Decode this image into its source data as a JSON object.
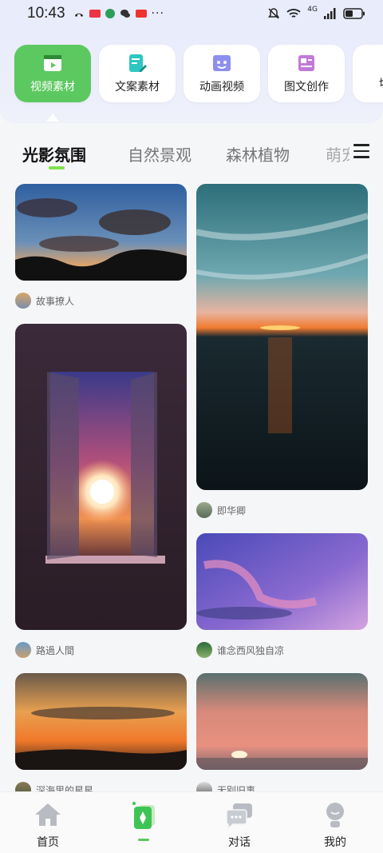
{
  "status_bar": {
    "time": "10:43",
    "network_label": "4G",
    "battery_level": 0.4
  },
  "categories": [
    {
      "label": "视频素材",
      "icon": "film-icon",
      "active": true
    },
    {
      "label": "文案素材",
      "icon": "document-pen-icon",
      "active": false
    },
    {
      "label": "动画视频",
      "icon": "animation-icon",
      "active": false
    },
    {
      "label": "图文创作",
      "icon": "image-text-icon",
      "active": false
    },
    {
      "label": "切",
      "icon": "cut-icon",
      "active": false
    }
  ],
  "tabs": [
    {
      "label": "光影氛围",
      "active": true
    },
    {
      "label": "自然景观",
      "active": false
    },
    {
      "label": "森林植物",
      "active": false
    },
    {
      "label": "萌宠",
      "active": false
    }
  ],
  "feed": {
    "left": [
      {
        "author": "故事撩人",
        "scene": "dusk-clouds"
      },
      {
        "author": "路過人間",
        "scene": "window-sunset"
      },
      {
        "author": "深海里的星星",
        "scene": "golden-sunset"
      }
    ],
    "right": [
      {
        "author": "即华卿",
        "scene": "sea-sunset"
      },
      {
        "author": "谁念西风独自凉",
        "scene": "purple-sky"
      },
      {
        "author": "无别旧事",
        "scene": "pink-horizon"
      }
    ]
  },
  "bottom_nav": [
    {
      "label": "首页",
      "icon": "home-icon"
    },
    {
      "label": "",
      "icon": "create-card-icon"
    },
    {
      "label": "对话",
      "icon": "chat-icon"
    },
    {
      "label": "我的",
      "icon": "profile-icon"
    }
  ],
  "colors": {
    "accent": "#5cc860",
    "tab_underline": "#7ee34a"
  }
}
